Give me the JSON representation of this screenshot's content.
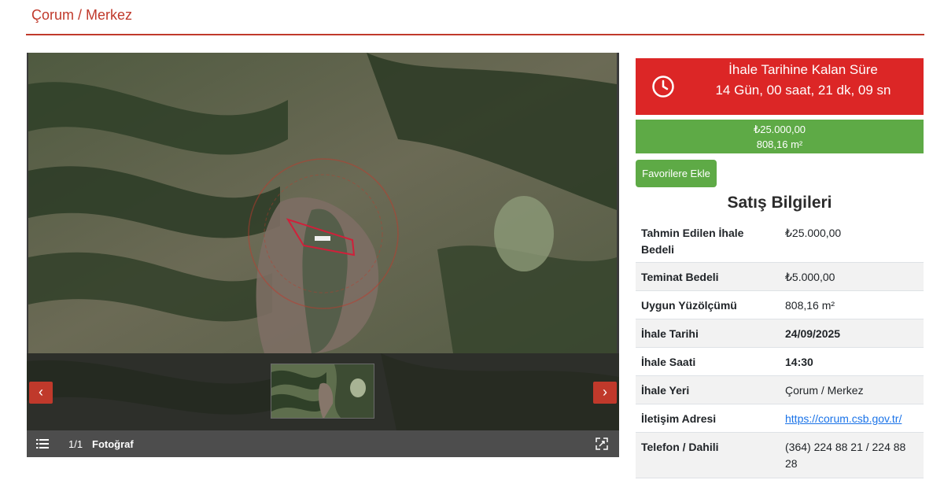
{
  "header": {
    "title": "Çorum / Merkez"
  },
  "gallery": {
    "counter": "1/1",
    "label": "Fotoğraf",
    "prev_label": "‹",
    "next_label": "›",
    "icons": [
      "list-icon",
      "expand-icon",
      "chevron-left-icon",
      "chevron-right-icon"
    ]
  },
  "countdown": {
    "label": "İhale Tarihine Kalan Süre",
    "value": "14 Gün, 00 saat, 21 dk, 09 sn",
    "icon": "clock-icon"
  },
  "price": {
    "amount": "₺25.000,00",
    "area": "808,16 m²"
  },
  "favorite_button": "Favorilere Ekle",
  "sales_info": {
    "title": "Satış Bilgileri",
    "rows": [
      {
        "label": "Tahmin Edilen İhale Bedeli",
        "value": "₺25.000,00"
      },
      {
        "label": "Teminat Bedeli",
        "value": "₺5.000,00"
      },
      {
        "label": "Uygun Yüzölçümü",
        "value": "808,16 m²"
      },
      {
        "label": "İhale Tarihi",
        "value": "24/09/2025"
      },
      {
        "label": "İhale Saati",
        "value": "14:30"
      },
      {
        "label": "İhale Yeri",
        "value": "Çorum / Merkez"
      },
      {
        "label": "İletişim Adresi",
        "value": "https://corum.csb.gov.tr/"
      },
      {
        "label": "Telefon / Dahili",
        "value": "(364) 224 88 21 / 224 88 28"
      }
    ]
  },
  "colors": {
    "brand_red": "#c0392b",
    "countdown_red": "#dc2626",
    "green": "#5eaa46",
    "link": "#1a73e8"
  }
}
